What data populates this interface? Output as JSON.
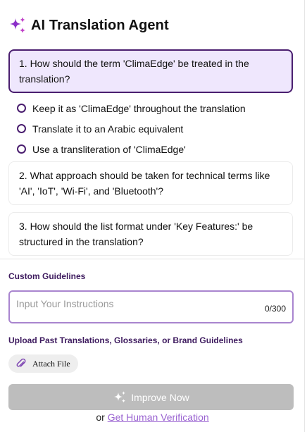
{
  "header": {
    "title": "AI Translation Agent",
    "icon": "sparkle-icon",
    "accent": "#8b2fc9"
  },
  "questions": [
    {
      "text": "1. How should the term 'ClimaEdge' be treated in the translation?",
      "options": [
        "Keep it as 'ClimaEdge' throughout the translation",
        "Translate it to an Arabic equivalent",
        "Use a transliteration of 'ClimaEdge'"
      ]
    },
    {
      "text": "2. What approach should be taken for technical terms like 'AI', 'IoT', 'Wi-Fi', and 'Bluetooth'?"
    },
    {
      "text": "3. How should the list format under 'Key Features:' be structured in the translation?"
    }
  ],
  "guidelines": {
    "label": "Custom Guidelines",
    "placeholder": "Input Your Instructions",
    "value": "",
    "counter": "0/300"
  },
  "upload": {
    "label": "Upload Past Translations, Glossaries, or Brand Guidelines",
    "attach_label": "Attach File",
    "icon": "paperclip-icon"
  },
  "improve_button": {
    "label": "Improve Now",
    "icon": "sparkle-icon",
    "color": "#bdbdbd"
  },
  "verification": {
    "prefix": "or",
    "link_label": "Get Human Verification",
    "link_color": "#9a63d1"
  },
  "colors": {
    "primary": "#4a1e6f",
    "active_bg": "#efe7fd",
    "input_border": "#a985cf"
  }
}
